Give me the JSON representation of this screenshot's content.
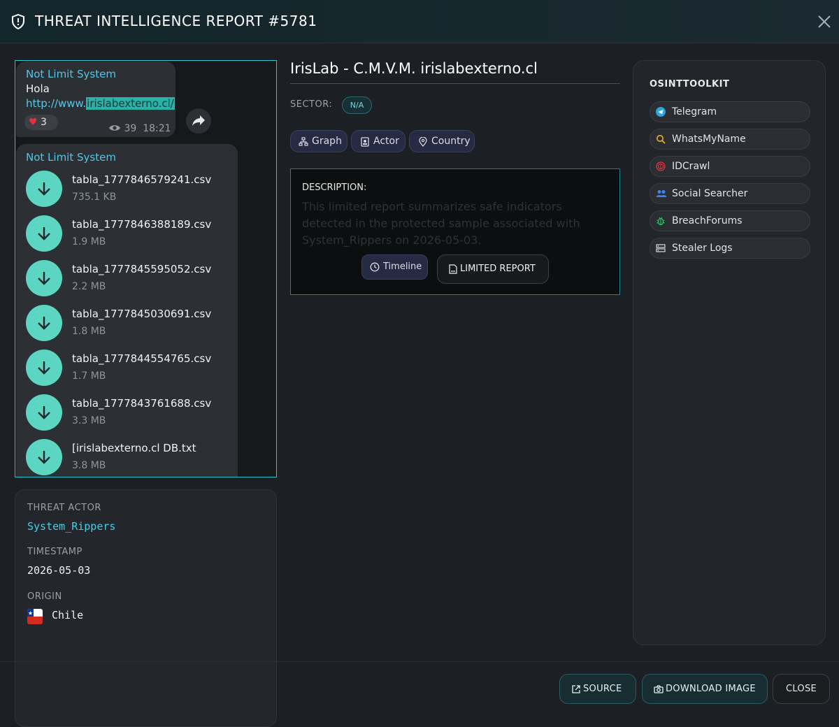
{
  "header": {
    "title": "THREAT INTELLIGENCE REPORT #5781",
    "icon": "shield-icon",
    "close_icon": "close-icon"
  },
  "preview": {
    "message1": {
      "sender": "Not Limit System",
      "text": "Hola",
      "link_prefix": "http://www.",
      "link_highlight": "irislabexterno.cl/",
      "reaction_emoji": "❤️",
      "reaction_count": "3",
      "views": "39",
      "time": "18:21"
    },
    "message2": {
      "sender": "Not Limit System",
      "files": [
        {
          "name": "tabla_1777846579241.csv",
          "size": "735.1 KB"
        },
        {
          "name": "tabla_1777846388189.csv",
          "size": "1.9 MB"
        },
        {
          "name": "tabla_1777845595052.csv",
          "size": "2.2 MB"
        },
        {
          "name": "tabla_1777845030691.csv",
          "size": "1.8 MB"
        },
        {
          "name": "tabla_1777844554765.csv",
          "size": "1.7 MB"
        },
        {
          "name": "tabla_1777843761688.csv",
          "size": "3.3 MB"
        },
        {
          "name": "[irislabexterno.cl DB.txt",
          "size": "3.8 MB"
        }
      ]
    }
  },
  "info": {
    "actor_label": "THREAT ACTOR",
    "actor_value": "System_Rippers",
    "timestamp_label": "TIMESTAMP",
    "timestamp_value": "2026-05-03",
    "origin_label": "ORIGIN",
    "origin_value": "Chile"
  },
  "report": {
    "title": "IrisLab - C.M.V.M. irislabexterno.cl",
    "sector_label": "SECTOR:",
    "sector_value": "N/A",
    "chips": [
      "Graph",
      "Actor",
      "Country"
    ],
    "description_label": "DESCRIPTION:",
    "description_text": "This limited report summarizes safe indicators detected in the protected sample associated with System_Rippers on 2026-05-03.",
    "timeline_label": "Timeline",
    "limited_report_label": "LIMITED REPORT"
  },
  "osint": {
    "title": "OSINTTOOLKIT",
    "tools": [
      "Telegram",
      "WhatsMyName",
      "IDCrawl",
      "Social Searcher",
      "BreachForums",
      "Stealer Logs"
    ]
  },
  "footer": {
    "source_label": "SOURCE",
    "download_label": "DOWNLOAD IMAGE",
    "close_label": "CLOSE"
  },
  "colors": {
    "accent": "#27c6d6",
    "download_button": "#5cd6c2",
    "actor_text": "#3ed0e8",
    "link": "#59c6e6"
  }
}
